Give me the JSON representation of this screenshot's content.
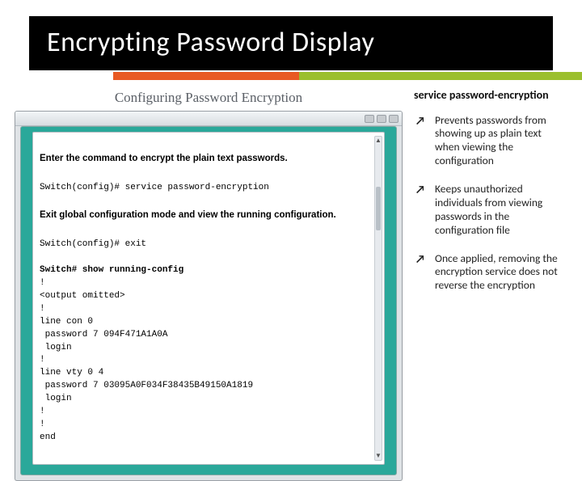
{
  "title": "Encrypting Password Display",
  "right": {
    "heading": "service password-encryption",
    "bullets": [
      "Prevents passwords from showing up as plain text when viewing the configuration",
      "Keeps unauthorized individuals from viewing passwords in the configuration file",
      "Once applied, removing the encryption service does not reverse the encryption"
    ]
  },
  "window": {
    "config_title": "Configuring Password Encryption",
    "instr1": "Enter the command to encrypt the plain text passwords.",
    "line1": "Switch(config)# service password-encryption",
    "instr2": "Exit global configuration mode and view the running configuration.",
    "line2": "Switch(config)# exit",
    "line3": "Switch# show running-config",
    "omitted": "<output omitted>",
    "cfg": [
      "!",
      "line con 0",
      " password 7 094F471A1A0A",
      " login",
      "!",
      "line vty 0 4",
      " password 7 03095A0F034F38435B49150A1819",
      " login",
      "!",
      "!",
      "end"
    ]
  }
}
